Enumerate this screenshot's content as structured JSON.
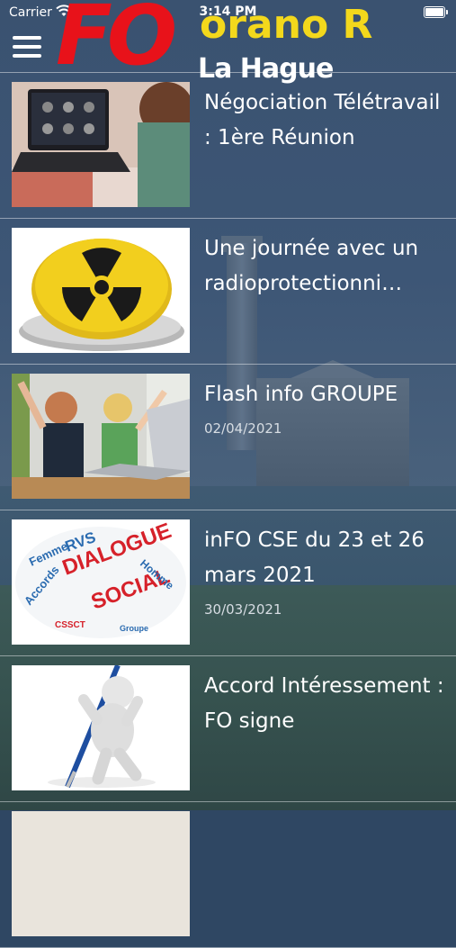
{
  "status_bar": {
    "carrier": "Carrier",
    "time": "3:14 PM"
  },
  "header": {
    "logo_fo": "FO",
    "logo_orano": "orano R",
    "logo_hague": "La Hague"
  },
  "articles": [
    {
      "title": "Négociation Télétravail : 1ère Réunion",
      "date": "",
      "thumb_icon": "laptop-video-call-icon"
    },
    {
      "title": "Une journée avec un radioprotectionni…",
      "date": "",
      "thumb_icon": "radiation-button-icon"
    },
    {
      "title": "Flash info GROUPE",
      "date": "02/04/2021",
      "thumb_icon": "kids-laptop-icon"
    },
    {
      "title": "inFO CSE du 23 et 26 mars 2021",
      "date": "30/03/2021",
      "thumb_icon": "word-cloud-icon"
    },
    {
      "title": "Accord Intéressement : FO signe",
      "date": "",
      "thumb_icon": "figure-with-pen-icon"
    }
  ],
  "colors": {
    "logo_red": "#e8121a",
    "logo_yellow": "#f3d81c",
    "background": "#2f4763"
  }
}
